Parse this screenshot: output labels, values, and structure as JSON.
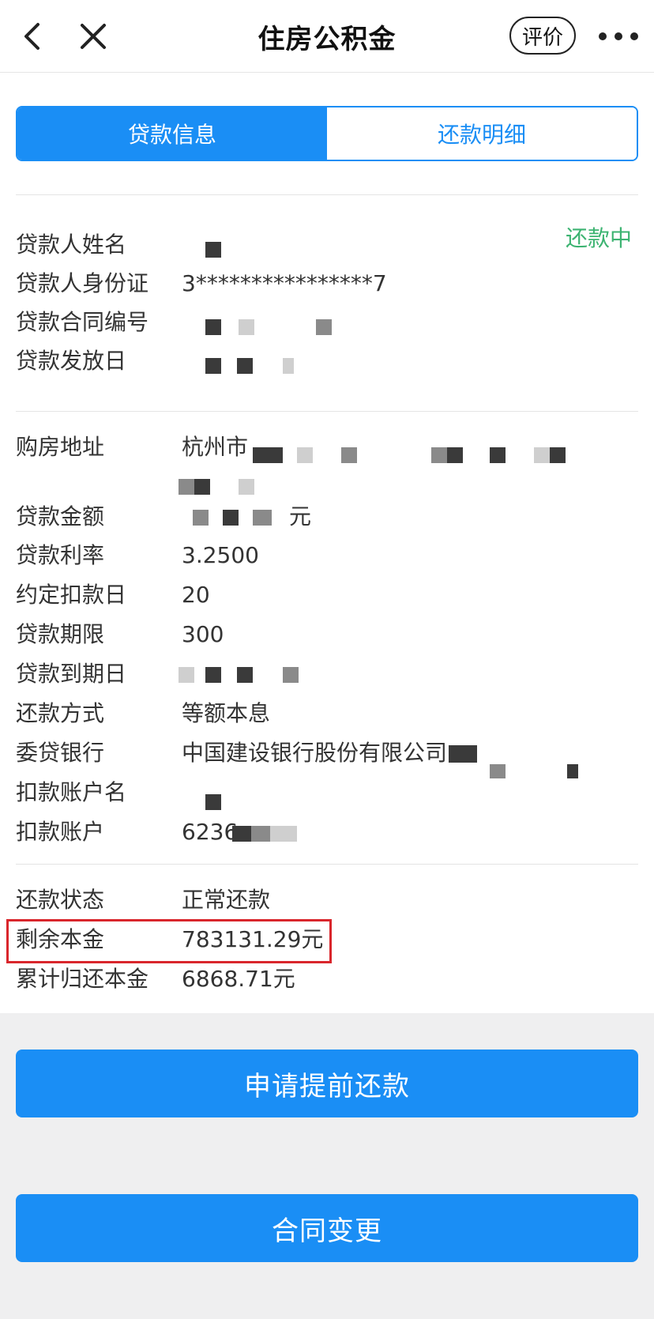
{
  "header": {
    "title": "住房公积金",
    "rate_label": "评价",
    "icons": [
      "back-arrow-icon",
      "close-icon",
      "more-icon"
    ]
  },
  "tabs": [
    {
      "label": "贷款信息",
      "active": true
    },
    {
      "label": "还款明细",
      "active": false
    }
  ],
  "status_tag": "还款中",
  "section1": [
    {
      "label": "贷款人姓名",
      "value": ""
    },
    {
      "label": "贷款人身份证",
      "value": "3****************7"
    },
    {
      "label": "贷款合同编号",
      "value": ""
    },
    {
      "label": "贷款发放日",
      "value": ""
    }
  ],
  "section2": [
    {
      "label": "购房地址",
      "value": "杭州市"
    },
    {
      "label": "贷款金额",
      "value": "元"
    },
    {
      "label": "贷款利率",
      "value": "3.2500"
    },
    {
      "label": "约定扣款日",
      "value": "20"
    },
    {
      "label": "贷款期限",
      "value": "300"
    },
    {
      "label": "贷款到期日",
      "value": ""
    },
    {
      "label": "还款方式",
      "value": "等额本息"
    },
    {
      "label": "委贷银行",
      "value": "中国建设银行股份有限公司"
    },
    {
      "label": "扣款账户名",
      "value": ""
    },
    {
      "label": "扣款账户",
      "value": "6236"
    }
  ],
  "section3": [
    {
      "label": "还款状态",
      "value": "正常还款"
    },
    {
      "label": "剩余本金",
      "value": "783131.29元"
    },
    {
      "label": "累计归还本金",
      "value": "6868.71元"
    }
  ],
  "buttons": {
    "prepay": "申请提前还款",
    "contract_change": "合同变更"
  },
  "colors": {
    "accent": "#1a8ef5",
    "status_green": "#3cb371",
    "highlight_red": "#d9262c"
  }
}
